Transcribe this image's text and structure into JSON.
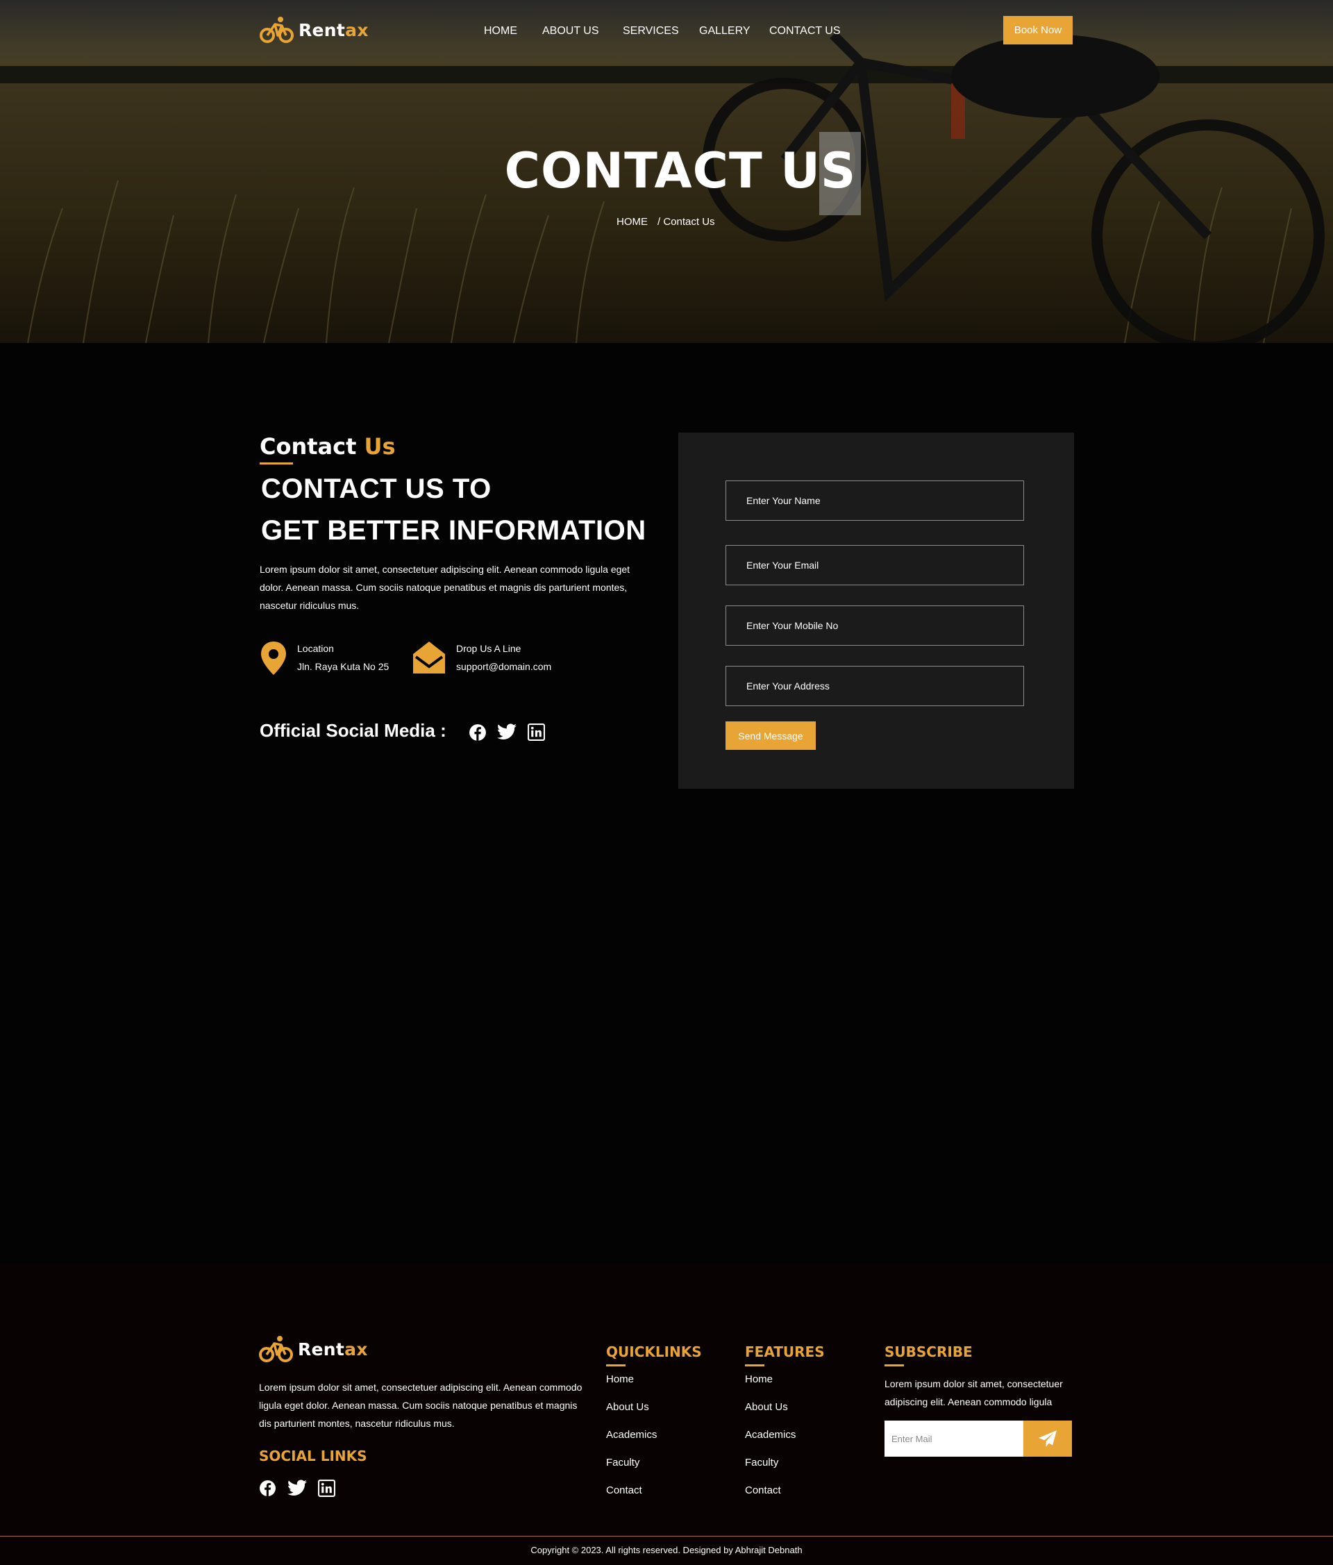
{
  "brand": {
    "name_part1": "Rent",
    "name_part2": "ax",
    "accent_color": "#e8a435",
    "logo_icon": "bicycle-icon"
  },
  "nav": {
    "items": [
      "HOME",
      "ABOUT US",
      "SERVICES",
      "GALLERY",
      "CONTACT US"
    ],
    "cta": "Book Now"
  },
  "hero": {
    "title": "CONTACT US",
    "breadcrumb_home": "HOME",
    "breadcrumb_current": "/ Contact Us"
  },
  "contact": {
    "label_part1": "Contact",
    "label_part2": "Us",
    "heading_line1": "CONTACT US TO",
    "heading_line2": "GET BETTER INFORMATION",
    "description": "Lorem ipsum dolor sit amet, consectetuer adipiscing elit. Aenean commodo ligula eget dolor. Aenean massa. Cum sociis natoque penatibus et magnis dis parturient montes, nascetur ridiculus mus.",
    "location_label": "Location",
    "location_value": "Jln. Raya Kuta No 25",
    "email_label": "Drop Us A Line",
    "email_value": "support@domain.com",
    "social_title": "Official Social Media :",
    "social_icons": [
      "facebook-icon",
      "twitter-icon",
      "linkedin-icon"
    ]
  },
  "form": {
    "name_placeholder": "Enter Your Name",
    "email_placeholder": "Enter Your Email",
    "mobile_placeholder": "Enter Your Mobile No",
    "address_placeholder": "Enter Your Address",
    "submit": "Send Message"
  },
  "footer": {
    "description": "Lorem ipsum dolor sit amet, consectetuer adipiscing elit. Aenean commodo ligula eget dolor. Aenean massa. Cum sociis natoque penatibus et magnis dis parturient montes, nascetur ridiculus mus.",
    "social_title": "SOCIAL LINKS",
    "quicklinks_title": "QUICKLINKS",
    "quicklinks": [
      "Home",
      "About Us",
      "Academics",
      "Faculty",
      "Contact"
    ],
    "features_title": "FEATURES",
    "features": [
      "Home",
      "About Us",
      "Academics",
      "Faculty",
      "Contact"
    ],
    "subscribe_title": "SUBSCRIBE",
    "subscribe_text": "Lorem ipsum dolor sit amet, consectetuer adipiscing elit. Aenean commodo ligula",
    "subscribe_placeholder": "Enter Mail",
    "copyright": "Copyright © 2023. All rights reserved. Designed by Abhrajit Debnath"
  }
}
